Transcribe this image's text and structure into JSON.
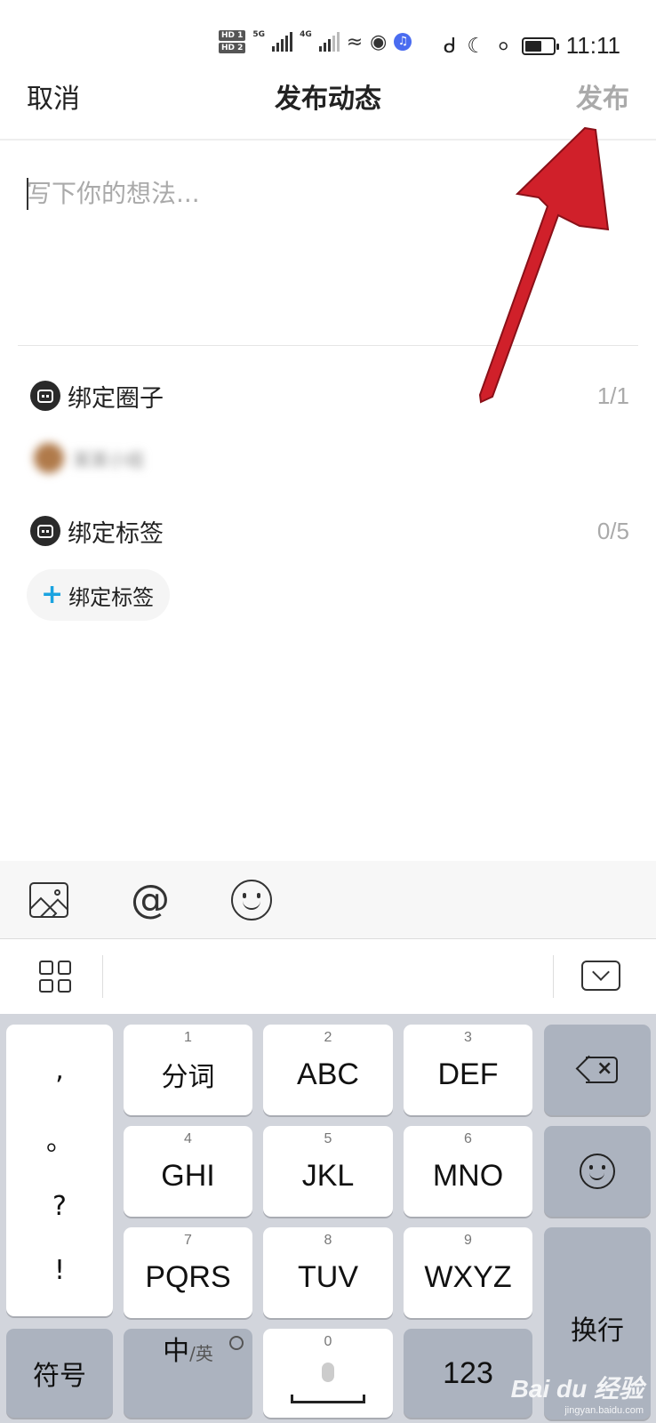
{
  "status_bar": {
    "hd1": "HD 1",
    "hd2": "HD 2",
    "net1": "5G",
    "net2": "4G",
    "time": "11:11"
  },
  "header": {
    "cancel": "取消",
    "title": "发布动态",
    "publish": "发布"
  },
  "composer": {
    "placeholder": "写下你的想法..."
  },
  "bind_circle": {
    "label": "绑定圈子",
    "count": "1/1",
    "item_name": "某某小组"
  },
  "bind_tag": {
    "label": "绑定标签",
    "count": "0/5",
    "add_label": "绑定标签",
    "add_plus": "+"
  },
  "toolbar": {
    "at": "@"
  },
  "keyboard": {
    "punct": [
      ",",
      "。",
      "?",
      "!"
    ],
    "rows": [
      [
        {
          "num": "1",
          "label": "分词"
        },
        {
          "num": "2",
          "label": "ABC"
        },
        {
          "num": "3",
          "label": "DEF"
        }
      ],
      [
        {
          "num": "4",
          "label": "GHI"
        },
        {
          "num": "5",
          "label": "JKL"
        },
        {
          "num": "6",
          "label": "MNO"
        }
      ],
      [
        {
          "num": "7",
          "label": "PQRS"
        },
        {
          "num": "8",
          "label": "TUV"
        },
        {
          "num": "9",
          "label": "WXYZ"
        }
      ]
    ],
    "symbols": "符号",
    "lang_main": "中",
    "lang_sub": "/英",
    "space_num": "0",
    "numbers": "123",
    "enter": "换行"
  },
  "colors": {
    "annotation_arrow": "#d0202a",
    "accent_plus": "#1aa3e0",
    "keyboard_bg": "#d2d5dc"
  },
  "watermark": {
    "logo": "Bai du 经验",
    "url": "jingyan.baidu.com"
  }
}
